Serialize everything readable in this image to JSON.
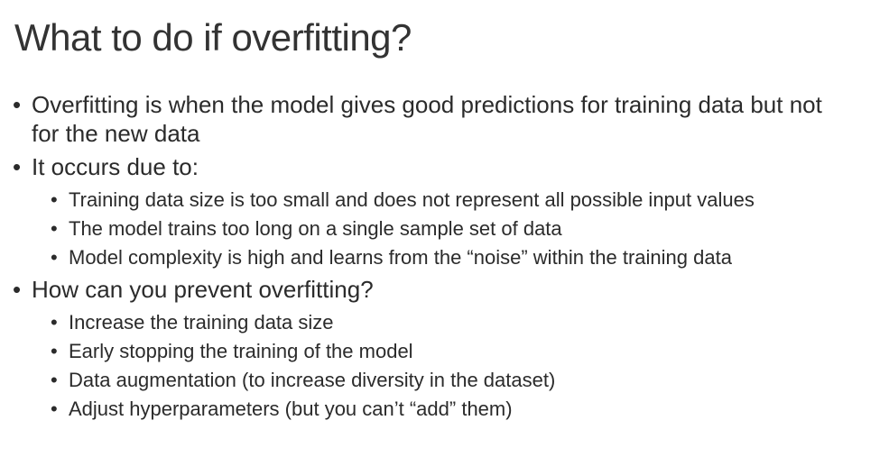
{
  "slide": {
    "title": "What to do if overfitting?",
    "bullet_glyph": "•",
    "points": [
      {
        "text": "Overfitting is when the model gives good predictions for training data but not for the new data",
        "subpoints": []
      },
      {
        "text": "It occurs due to:",
        "subpoints": [
          "Training data size is too small and does not represent all possible input values",
          "The model trains too long on a single sample set of data",
          "Model complexity is high and learns from the “noise” within the training data"
        ]
      },
      {
        "text": "How can you prevent overfitting?",
        "subpoints": [
          "Increase the training data size",
          "Early stopping the training of the model",
          "Data augmentation (to increase diversity in the dataset)",
          "Adjust hyperparameters (but you can’t “add” them)"
        ]
      }
    ]
  }
}
